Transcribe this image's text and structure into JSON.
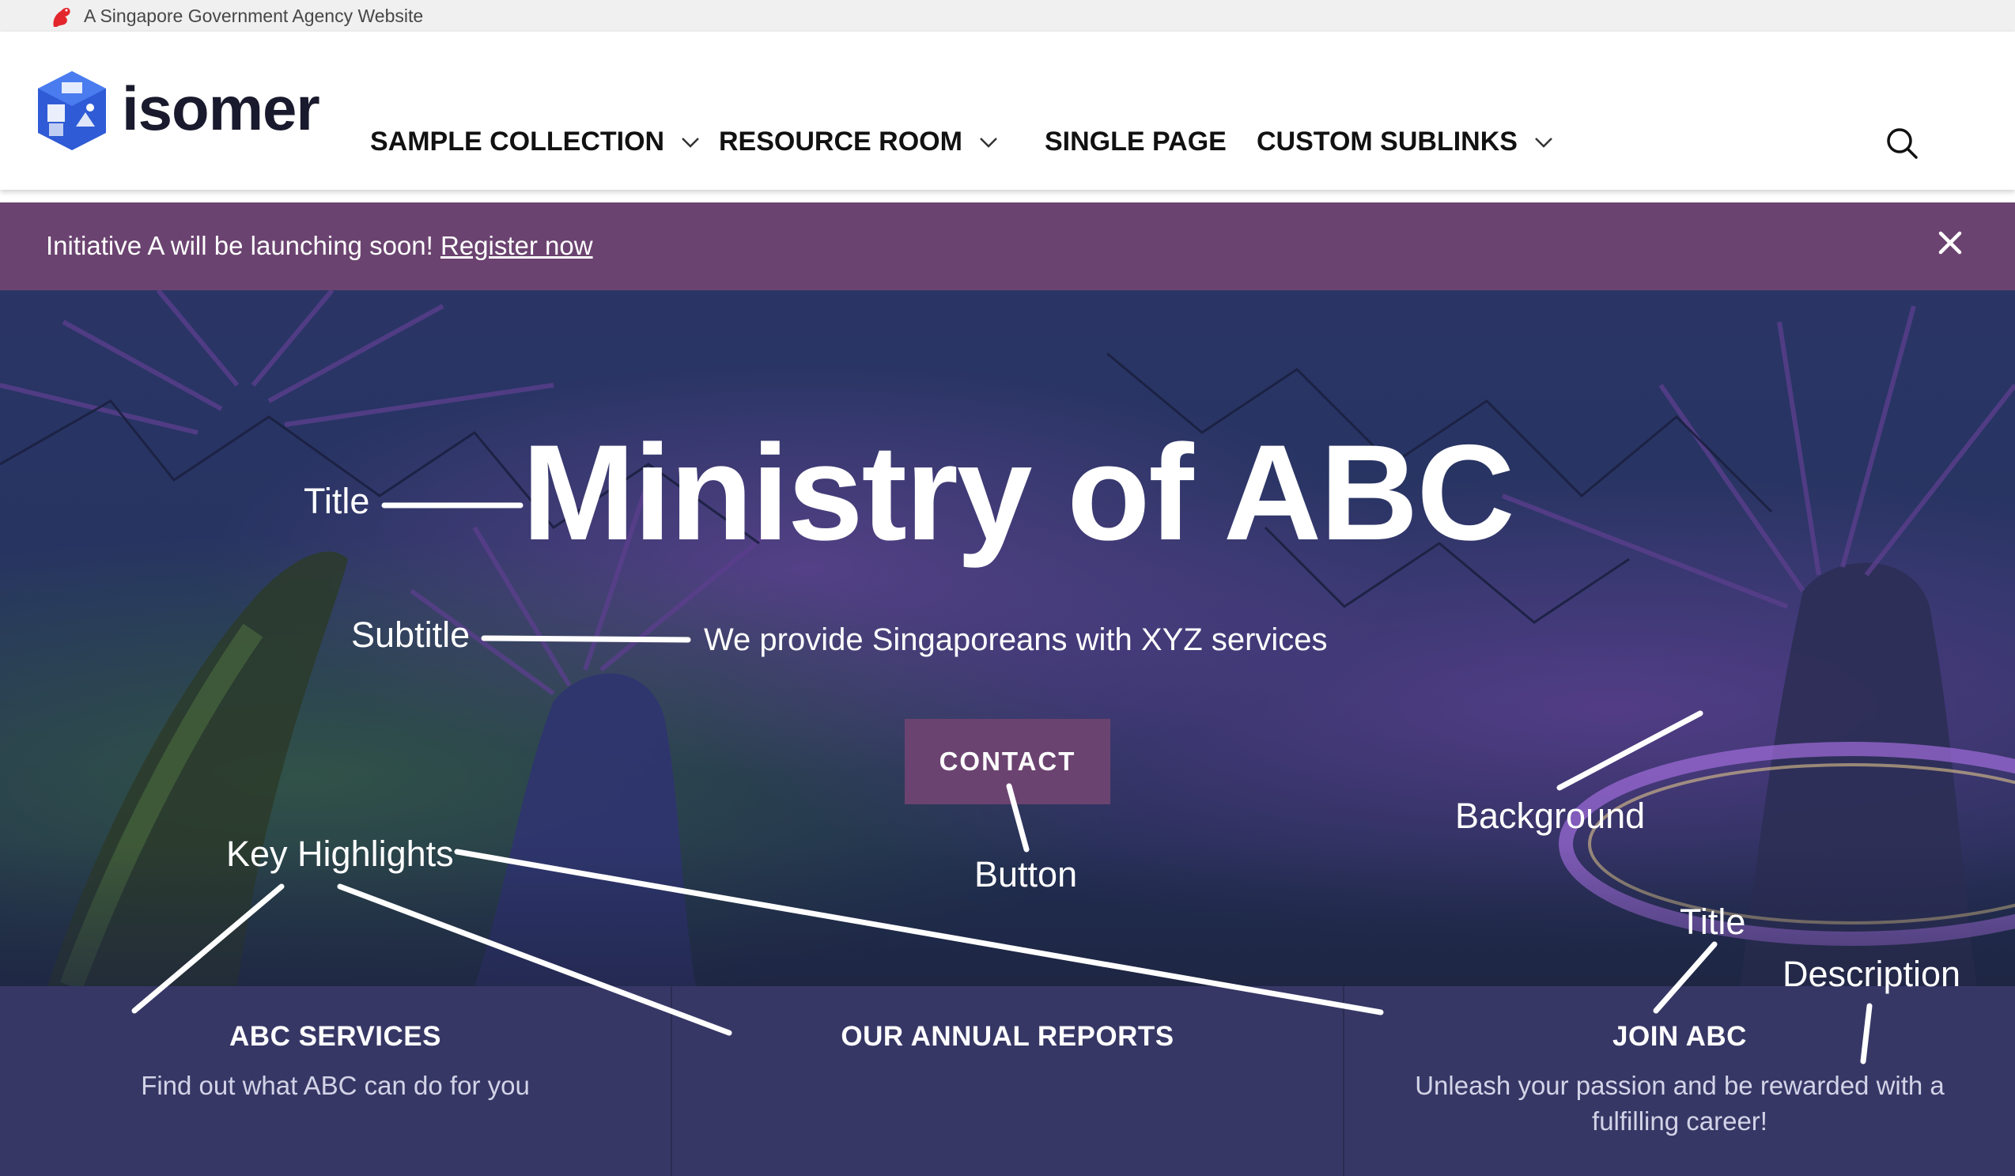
{
  "masthead": {
    "text": "A Singapore Government Agency Website"
  },
  "header": {
    "logo_text": "isomer",
    "nav": [
      {
        "label": "SAMPLE COLLECTION",
        "has_dropdown": true
      },
      {
        "label": "RESOURCE ROOM",
        "has_dropdown": true
      },
      {
        "label": "SINGLE PAGE",
        "has_dropdown": false
      },
      {
        "label": "CUSTOM SUBLINKS",
        "has_dropdown": true
      }
    ],
    "search_icon": "search-icon"
  },
  "notification": {
    "text": "Initiative A will be launching soon! ",
    "link": "Register now",
    "close_icon": "close-icon"
  },
  "hero": {
    "title": "Ministry of ABC",
    "subtitle": "We provide Singaporeans with XYZ services",
    "button": "CONTACT"
  },
  "annotations": {
    "title": "Title",
    "subtitle": "Subtitle",
    "button": "Button",
    "background": "Background",
    "key_highlights": "Key Highlights",
    "highlight_title": "Title",
    "highlight_description": "Description"
  },
  "highlights": [
    {
      "title": "ABC SERVICES",
      "description": "Find out what ABC can do for you"
    },
    {
      "title": "OUR ANNUAL REPORTS",
      "description": ""
    },
    {
      "title": "JOIN ABC",
      "description": "Unleash your passion and be rewarded with a fulfilling career!"
    }
  ],
  "colors": {
    "brand_purple": "#6b4370",
    "highlights_bg": "#373766",
    "masthead_bg": "#f0f0f0"
  }
}
